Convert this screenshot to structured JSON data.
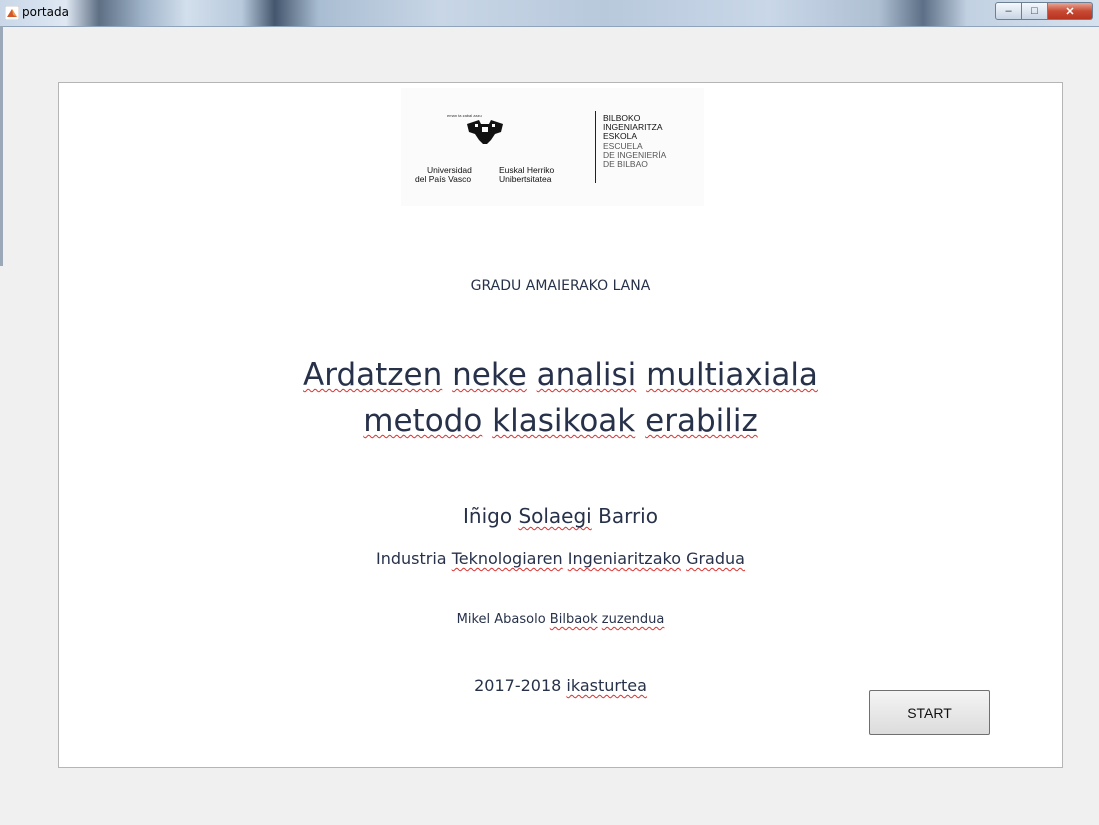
{
  "window": {
    "title": "portada",
    "minimize_glyph": "–",
    "maximize_glyph": "□",
    "close_glyph": "✕",
    "app_icon": "matlab-icon"
  },
  "logo": {
    "tagline": "eman ta zabal zazu",
    "university_es_1": "Universidad",
    "university_es_2": "del País Vasco",
    "university_eu_1": "Euskal Herriko",
    "university_eu_2": "Unibertsitatea",
    "school_eu_1": "BILBOKO",
    "school_eu_2": "INGENIARITZA",
    "school_eu_3": "ESKOLA",
    "school_es_1": "ESCUELA",
    "school_es_2": "DE INGENIERÍA",
    "school_es_3": "DE BILBAO"
  },
  "cover": {
    "doc_type": "GRADU AMAIERAKO LANA",
    "title_line1": {
      "w1": "Ardatzen",
      "w2": "neke",
      "w3": "analisi",
      "w4": "multiaxiala"
    },
    "title_line2": {
      "w1": "metodo",
      "w2": "klasikoak",
      "w3": "erabiliz"
    },
    "author": {
      "first": "Iñigo",
      "middle": "Solaegi",
      "last": "Barrio"
    },
    "degree": {
      "w1": "Industria",
      "w2": "Teknologiaren",
      "w3": "Ingeniaritzako",
      "w4": "Gradua"
    },
    "director": {
      "prefix": "Mikel Abasolo",
      "w1": "Bilbaok",
      "w2": "zuzendua"
    },
    "year": {
      "range": "2017-2018",
      "word": "ikasturtea"
    }
  },
  "start_button": {
    "label": "START"
  }
}
